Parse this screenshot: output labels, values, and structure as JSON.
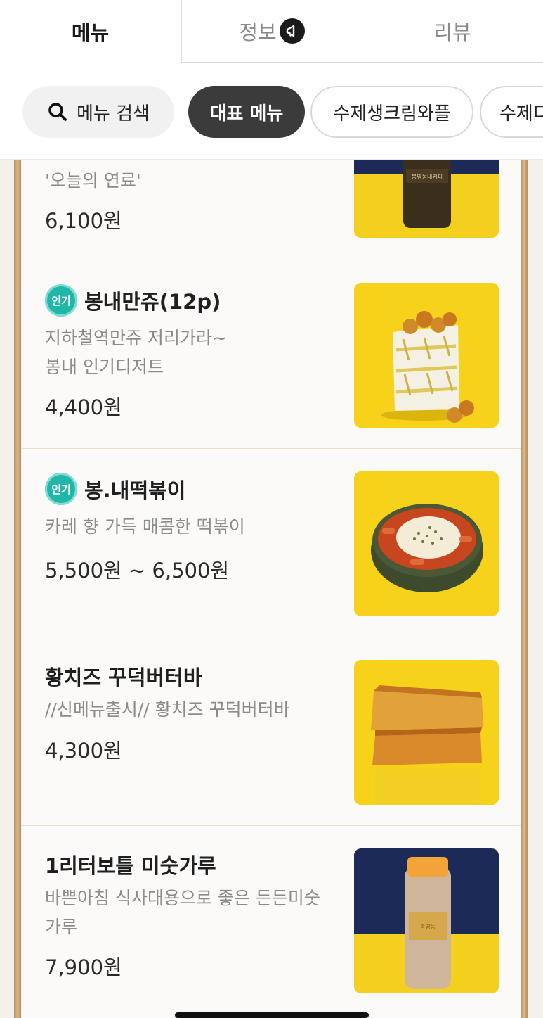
{
  "tabs": [
    {
      "label": "메뉴",
      "active": true
    },
    {
      "label": "정보",
      "icon": "megaphone-icon"
    },
    {
      "label": "리뷰"
    }
  ],
  "chips": {
    "search_label": "메뉴 검색",
    "search_icon": "search-icon",
    "items": [
      "대표 메뉴",
      "수제생크림와플",
      "수제디"
    ]
  },
  "colors": {
    "badge": "#21b7a8",
    "active_chip": "#3b3b3b",
    "rail": "#c9a06e",
    "thumb_yellow": "#f6d21a"
  },
  "menu_items": [
    {
      "name": "",
      "desc": "'오늘의 연료'",
      "price": "6,100원",
      "popular": false,
      "image": "coffee-bottle-image"
    },
    {
      "name": "봉내만쥬(12p)",
      "desc": "지하철역만쥬 저리가라~\n봉내 인기디저트",
      "price": "4,400원",
      "popular": true,
      "badge": "인기",
      "image": "manju-bag-image"
    },
    {
      "name": "봉.내떡볶이",
      "desc": "카레 향 가득 매콤한 떡볶이",
      "price": "5,500원 ~ 6,500원",
      "popular": true,
      "badge": "인기",
      "image": "tteokbokki-image"
    },
    {
      "name": "황치즈 꾸덕버터바",
      "desc": "//신메뉴출시// 황치즈 꾸덕버터바",
      "price": "4,300원",
      "popular": false,
      "image": "butter-bar-image"
    },
    {
      "name": "1리터보틀 미숫가루",
      "desc": "바쁜아침 식사대용으로 좋은 든든미숫\n가루",
      "price": "7,900원",
      "popular": false,
      "image": "misutgaru-bottle-image"
    }
  ]
}
